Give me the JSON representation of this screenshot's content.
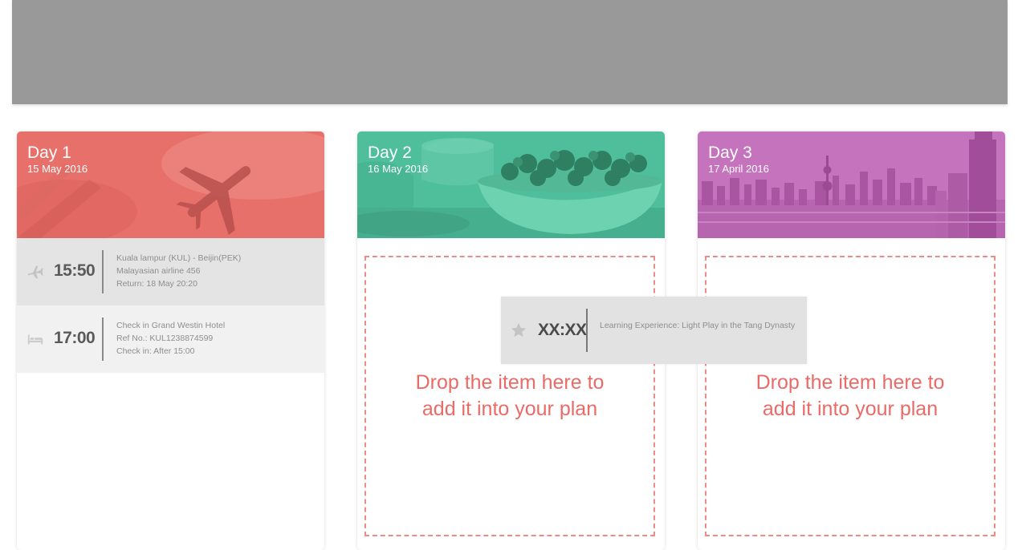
{
  "colors": {
    "top_bar": "#999999",
    "day1_header": "#e8706b",
    "day2_header": "#4fbf9b",
    "day3_header": "#c573bd",
    "drop_accent": "#e96b67"
  },
  "days": [
    {
      "day_label": "Day 1",
      "date": "15 May 2016",
      "header_image": "airplane-sky",
      "items": [
        {
          "icon": "airplane-icon",
          "time": "15:50",
          "lines": [
            "Kuala lampur (KUL) - Beijin(PEK)",
            "Malayasian airline 456",
            "Return: 18 May 20:20"
          ]
        },
        {
          "icon": "bed-icon",
          "time": "17:00",
          "lines": [
            "Check in Grand Westin Hotel",
            "Ref No.: KUL1238874599",
            "Check in: After 15:00"
          ]
        }
      ]
    },
    {
      "day_label": "Day 2",
      "date": "16 May 2016",
      "header_image": "food-bowl",
      "drop_text": [
        "Drop the item here to",
        "add it into your plan"
      ]
    },
    {
      "day_label": "Day 3",
      "date": "17 April 2016",
      "header_image": "city-skyline",
      "drop_text": [
        "Drop the item here to",
        "add it into your plan"
      ]
    }
  ],
  "dragged_item": {
    "icon": "star-icon",
    "time": "XX:XX",
    "title": "Learning Experience: Light Play in the Tang Dynasty"
  }
}
